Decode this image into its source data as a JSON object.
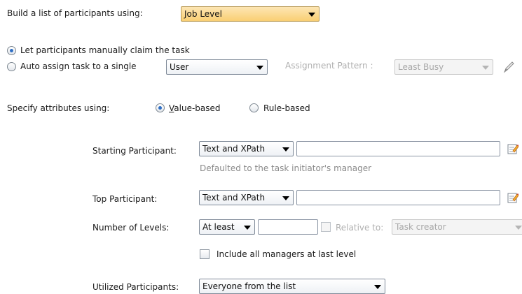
{
  "build": {
    "label": "Build a list of participants using:",
    "selected": "Job Level"
  },
  "claim": {
    "manual_label": "Let participants manually claim the task",
    "auto_label": "Auto assign task to a single",
    "auto_selected": "User",
    "pattern_label": "Assignment Pattern :",
    "pattern_selected": "Least Busy"
  },
  "specify": {
    "label": "Specify attributes using:",
    "value_based_prefix": "V",
    "value_based_rest": "alue-based",
    "rule_based": "Rule-based"
  },
  "starting": {
    "label": "Starting Participant:",
    "type": "Text and XPath",
    "value": "",
    "hint": "Defaulted to the task initiator's manager"
  },
  "top": {
    "label": "Top Participant:",
    "type": "Text and XPath",
    "value": ""
  },
  "levels": {
    "label": "Number of Levels:",
    "mode": "At least",
    "value": "",
    "relative_label": "Relative to:",
    "relative_selected": "Task creator"
  },
  "include_all": {
    "label": "Include all managers at last level"
  },
  "utilized": {
    "label": "Utilized Participants:",
    "selected": "Everyone from the list"
  },
  "colors": {
    "accent_radio": "#2f6fc5",
    "orange_dropdown": "#f9cf73",
    "disabled_text": "#b0b0b0"
  }
}
